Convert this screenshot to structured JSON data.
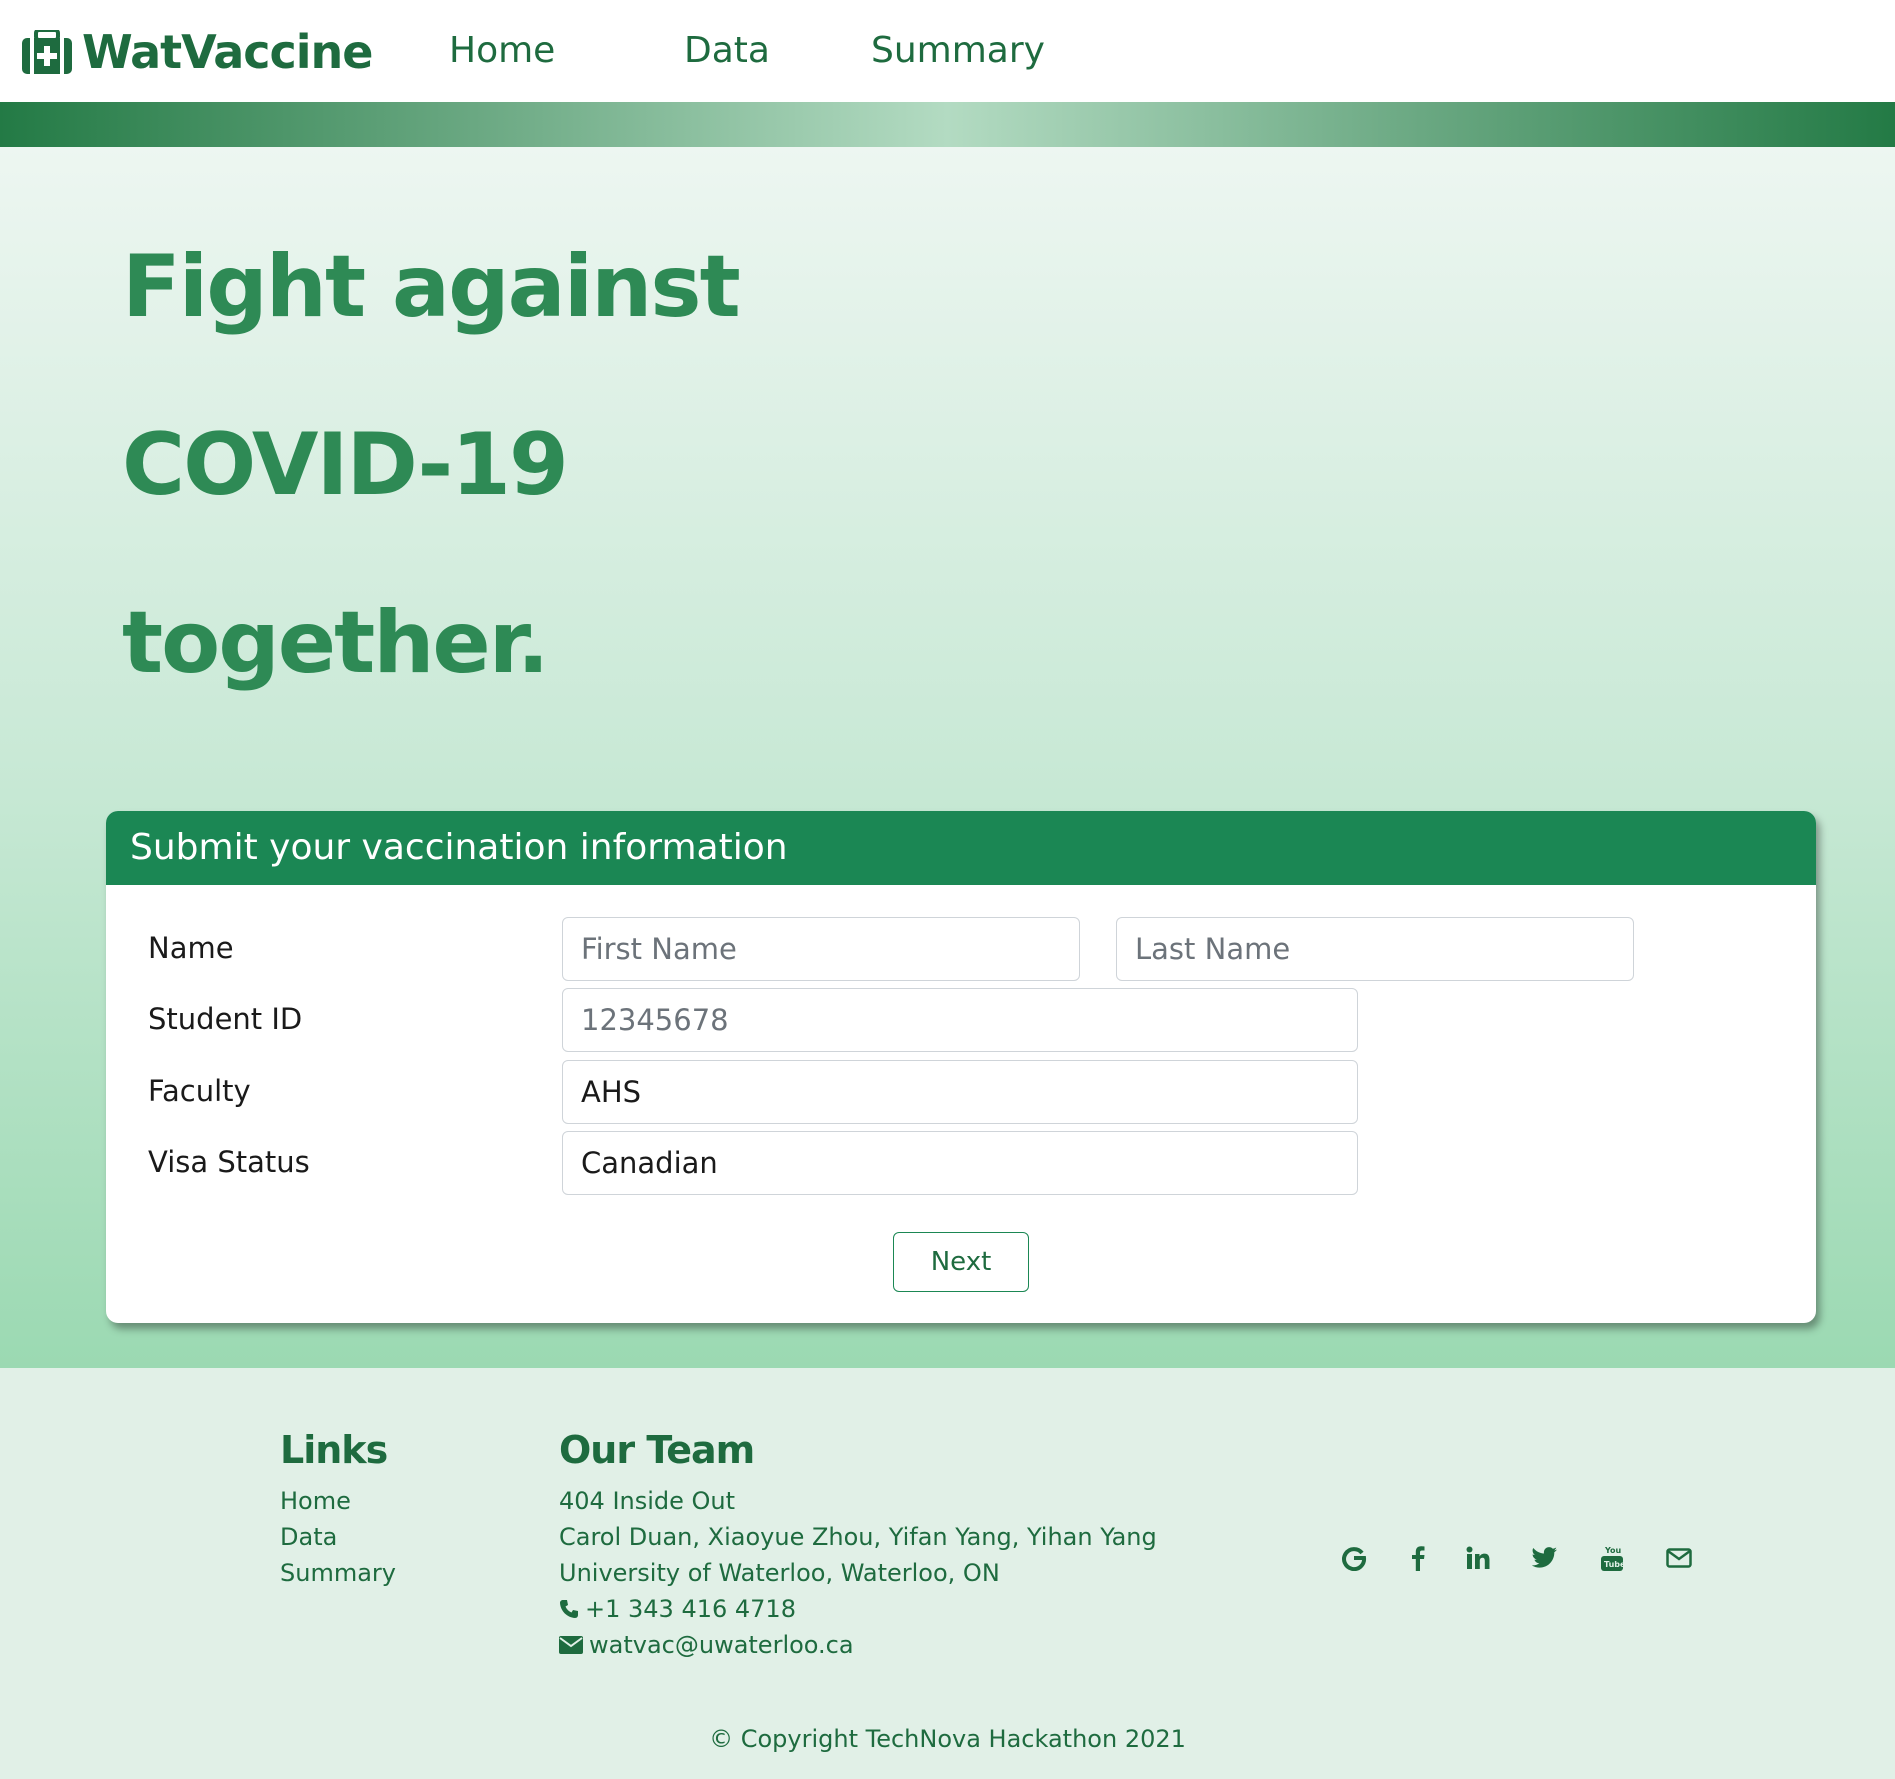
{
  "nav": {
    "brand": "WatVaccine",
    "links": [
      "Home",
      "Data",
      "Summary"
    ]
  },
  "hero": {
    "lines": [
      "Fight against",
      "COVID-19",
      "together."
    ]
  },
  "form": {
    "title": "Submit your vaccination information",
    "name_label": "Name",
    "first_name_placeholder": "First Name",
    "last_name_placeholder": "Last Name",
    "student_id_label": "Student ID",
    "student_id_placeholder": "12345678",
    "faculty_label": "Faculty",
    "faculty_value": "AHS",
    "visa_label": "Visa Status",
    "visa_value": "Canadian",
    "next_label": "Next"
  },
  "footer": {
    "links_heading": "Links",
    "links": [
      "Home",
      "Data",
      "Summary"
    ],
    "team_heading": "Our Team",
    "team_name": "404 Inside Out",
    "members": "Carol Duan, Xiaoyue Zhou, Yifan Yang, Yihan Yang",
    "address": "University of Waterloo, Waterloo, ON",
    "phone": "+1 343 416 4718",
    "email": "watvac@uwaterloo.ca",
    "social_icons": [
      "google-icon",
      "facebook-icon",
      "linkedin-icon",
      "twitter-icon",
      "youtube-icon",
      "envelope-icon"
    ],
    "copyright": "© Copyright TechNova Hackathon 2021"
  },
  "colors": {
    "primary": "#1b8754",
    "text_green": "#1e6b3f",
    "hero_text": "#2e8a55"
  }
}
